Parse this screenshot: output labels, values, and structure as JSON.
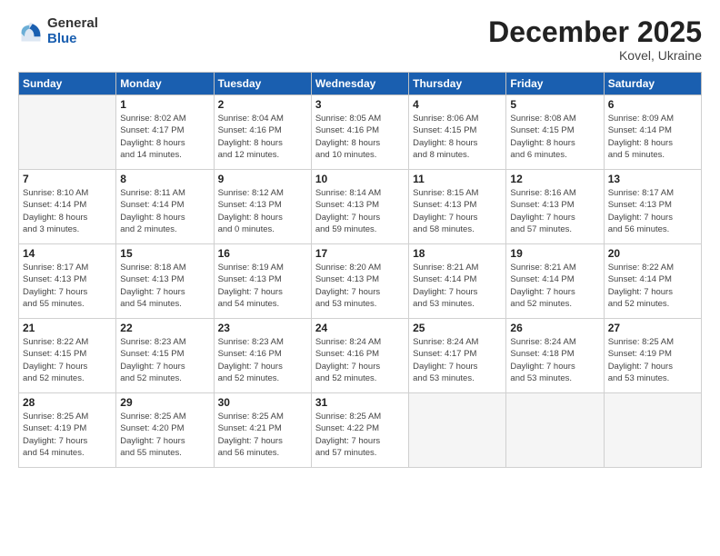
{
  "logo": {
    "general": "General",
    "blue": "Blue"
  },
  "title": "December 2025",
  "subtitle": "Kovel, Ukraine",
  "days_header": [
    "Sunday",
    "Monday",
    "Tuesday",
    "Wednesday",
    "Thursday",
    "Friday",
    "Saturday"
  ],
  "weeks": [
    [
      {
        "day": "",
        "info": ""
      },
      {
        "day": "1",
        "info": "Sunrise: 8:02 AM\nSunset: 4:17 PM\nDaylight: 8 hours\nand 14 minutes."
      },
      {
        "day": "2",
        "info": "Sunrise: 8:04 AM\nSunset: 4:16 PM\nDaylight: 8 hours\nand 12 minutes."
      },
      {
        "day": "3",
        "info": "Sunrise: 8:05 AM\nSunset: 4:16 PM\nDaylight: 8 hours\nand 10 minutes."
      },
      {
        "day": "4",
        "info": "Sunrise: 8:06 AM\nSunset: 4:15 PM\nDaylight: 8 hours\nand 8 minutes."
      },
      {
        "day": "5",
        "info": "Sunrise: 8:08 AM\nSunset: 4:15 PM\nDaylight: 8 hours\nand 6 minutes."
      },
      {
        "day": "6",
        "info": "Sunrise: 8:09 AM\nSunset: 4:14 PM\nDaylight: 8 hours\nand 5 minutes."
      }
    ],
    [
      {
        "day": "7",
        "info": "Sunrise: 8:10 AM\nSunset: 4:14 PM\nDaylight: 8 hours\nand 3 minutes."
      },
      {
        "day": "8",
        "info": "Sunrise: 8:11 AM\nSunset: 4:14 PM\nDaylight: 8 hours\nand 2 minutes."
      },
      {
        "day": "9",
        "info": "Sunrise: 8:12 AM\nSunset: 4:13 PM\nDaylight: 8 hours\nand 0 minutes."
      },
      {
        "day": "10",
        "info": "Sunrise: 8:14 AM\nSunset: 4:13 PM\nDaylight: 7 hours\nand 59 minutes."
      },
      {
        "day": "11",
        "info": "Sunrise: 8:15 AM\nSunset: 4:13 PM\nDaylight: 7 hours\nand 58 minutes."
      },
      {
        "day": "12",
        "info": "Sunrise: 8:16 AM\nSunset: 4:13 PM\nDaylight: 7 hours\nand 57 minutes."
      },
      {
        "day": "13",
        "info": "Sunrise: 8:17 AM\nSunset: 4:13 PM\nDaylight: 7 hours\nand 56 minutes."
      }
    ],
    [
      {
        "day": "14",
        "info": "Sunrise: 8:17 AM\nSunset: 4:13 PM\nDaylight: 7 hours\nand 55 minutes."
      },
      {
        "day": "15",
        "info": "Sunrise: 8:18 AM\nSunset: 4:13 PM\nDaylight: 7 hours\nand 54 minutes."
      },
      {
        "day": "16",
        "info": "Sunrise: 8:19 AM\nSunset: 4:13 PM\nDaylight: 7 hours\nand 54 minutes."
      },
      {
        "day": "17",
        "info": "Sunrise: 8:20 AM\nSunset: 4:13 PM\nDaylight: 7 hours\nand 53 minutes."
      },
      {
        "day": "18",
        "info": "Sunrise: 8:21 AM\nSunset: 4:14 PM\nDaylight: 7 hours\nand 53 minutes."
      },
      {
        "day": "19",
        "info": "Sunrise: 8:21 AM\nSunset: 4:14 PM\nDaylight: 7 hours\nand 52 minutes."
      },
      {
        "day": "20",
        "info": "Sunrise: 8:22 AM\nSunset: 4:14 PM\nDaylight: 7 hours\nand 52 minutes."
      }
    ],
    [
      {
        "day": "21",
        "info": "Sunrise: 8:22 AM\nSunset: 4:15 PM\nDaylight: 7 hours\nand 52 minutes."
      },
      {
        "day": "22",
        "info": "Sunrise: 8:23 AM\nSunset: 4:15 PM\nDaylight: 7 hours\nand 52 minutes."
      },
      {
        "day": "23",
        "info": "Sunrise: 8:23 AM\nSunset: 4:16 PM\nDaylight: 7 hours\nand 52 minutes."
      },
      {
        "day": "24",
        "info": "Sunrise: 8:24 AM\nSunset: 4:16 PM\nDaylight: 7 hours\nand 52 minutes."
      },
      {
        "day": "25",
        "info": "Sunrise: 8:24 AM\nSunset: 4:17 PM\nDaylight: 7 hours\nand 53 minutes."
      },
      {
        "day": "26",
        "info": "Sunrise: 8:24 AM\nSunset: 4:18 PM\nDaylight: 7 hours\nand 53 minutes."
      },
      {
        "day": "27",
        "info": "Sunrise: 8:25 AM\nSunset: 4:19 PM\nDaylight: 7 hours\nand 53 minutes."
      }
    ],
    [
      {
        "day": "28",
        "info": "Sunrise: 8:25 AM\nSunset: 4:19 PM\nDaylight: 7 hours\nand 54 minutes."
      },
      {
        "day": "29",
        "info": "Sunrise: 8:25 AM\nSunset: 4:20 PM\nDaylight: 7 hours\nand 55 minutes."
      },
      {
        "day": "30",
        "info": "Sunrise: 8:25 AM\nSunset: 4:21 PM\nDaylight: 7 hours\nand 56 minutes."
      },
      {
        "day": "31",
        "info": "Sunrise: 8:25 AM\nSunset: 4:22 PM\nDaylight: 7 hours\nand 57 minutes."
      },
      {
        "day": "",
        "info": ""
      },
      {
        "day": "",
        "info": ""
      },
      {
        "day": "",
        "info": ""
      }
    ]
  ]
}
